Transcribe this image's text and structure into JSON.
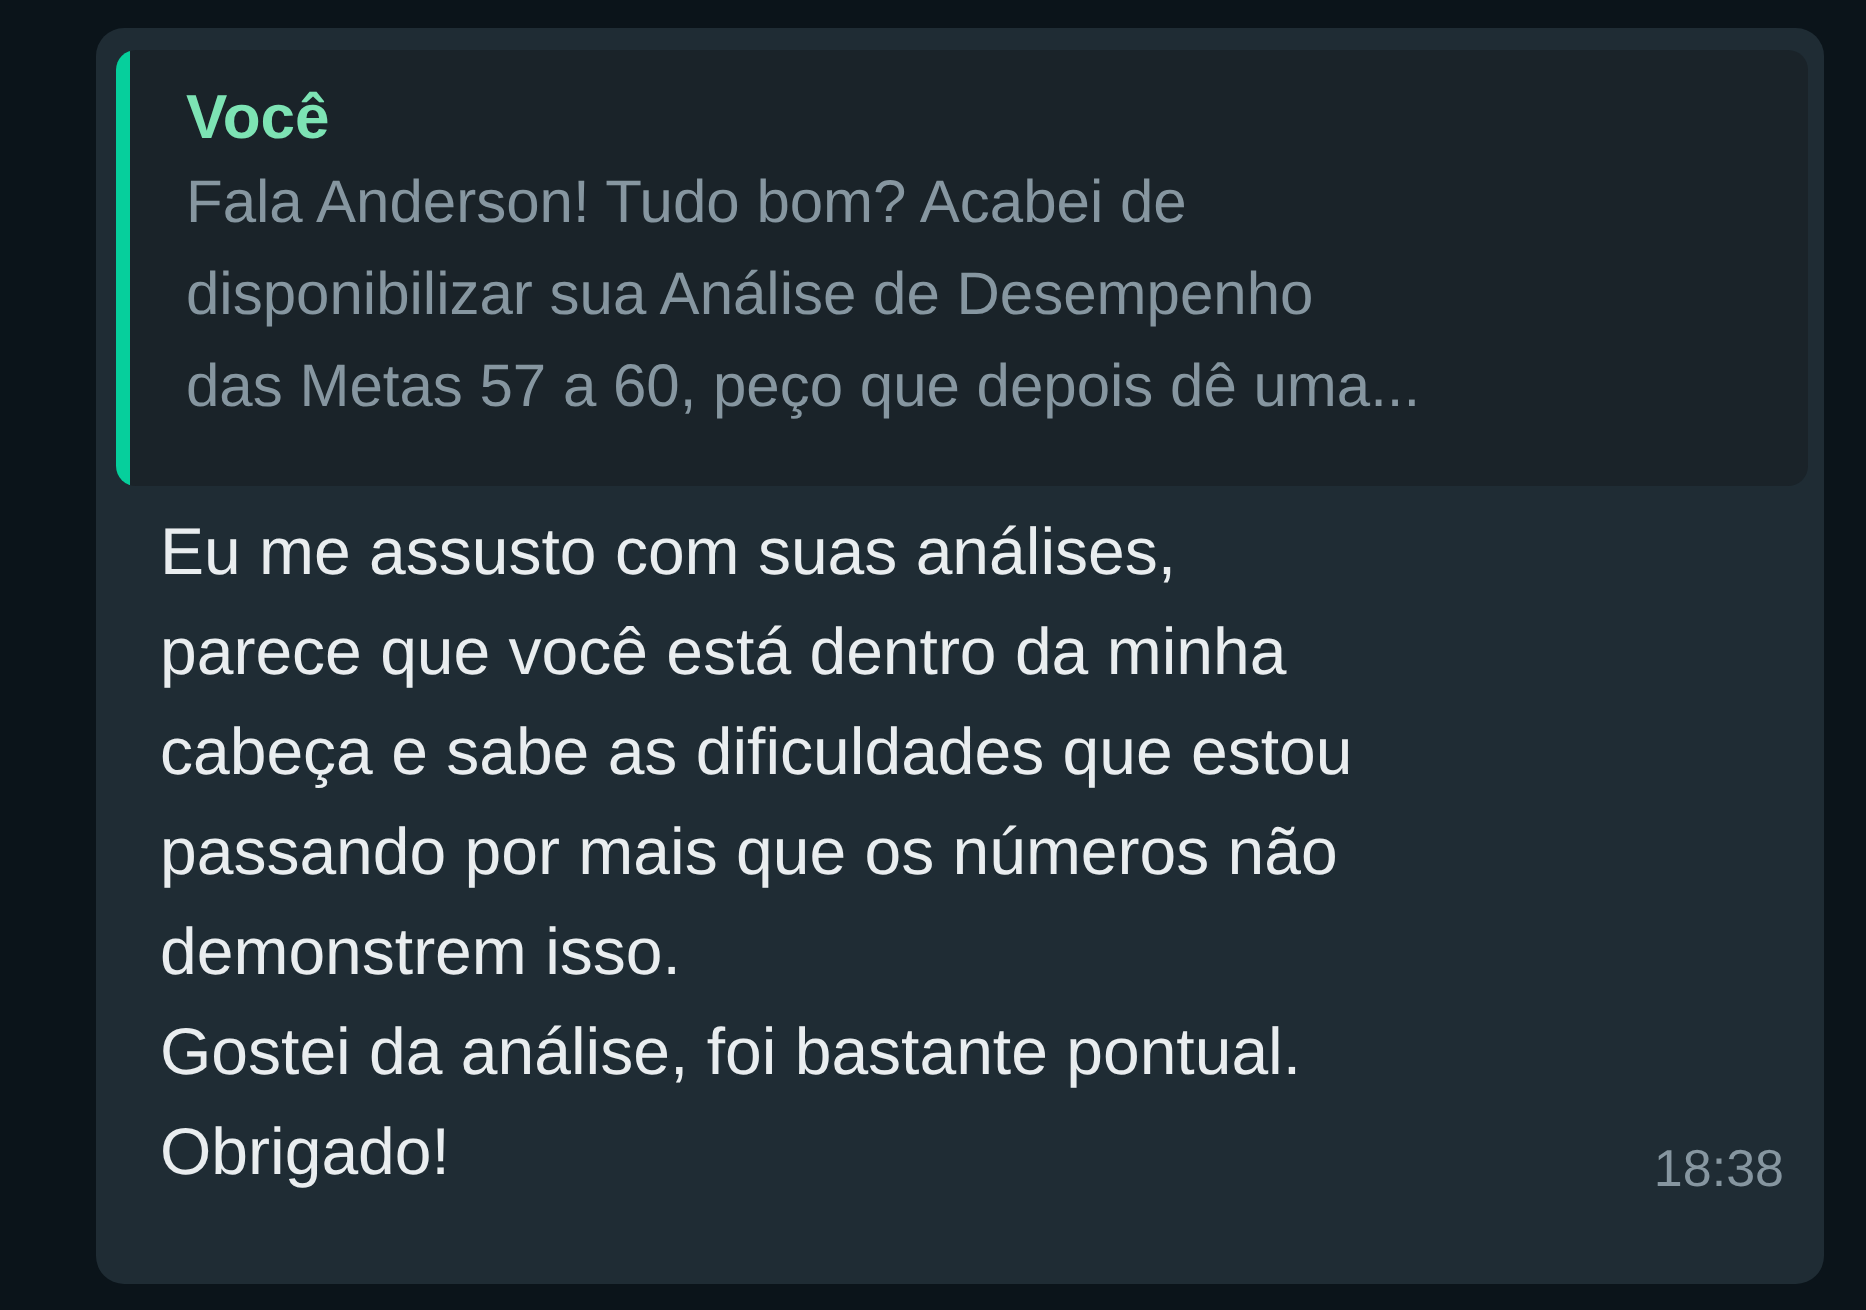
{
  "message": {
    "quote": {
      "author": "Você",
      "text": "Fala Anderson! Tudo bom? Acabei de\ndisponibilizar sua Análise de Desempenho\ndas Metas 57 a 60, peço que depois dê uma..."
    },
    "text": "Eu me assusto com suas análises,\nparece que você está dentro da minha\ncabeça e sabe as dificuldades que estou\npassando por mais que os números não\ndemonstrem isso.\nGostei da análise, foi bastante pontual.\nObrigado!",
    "time": "18:38"
  }
}
